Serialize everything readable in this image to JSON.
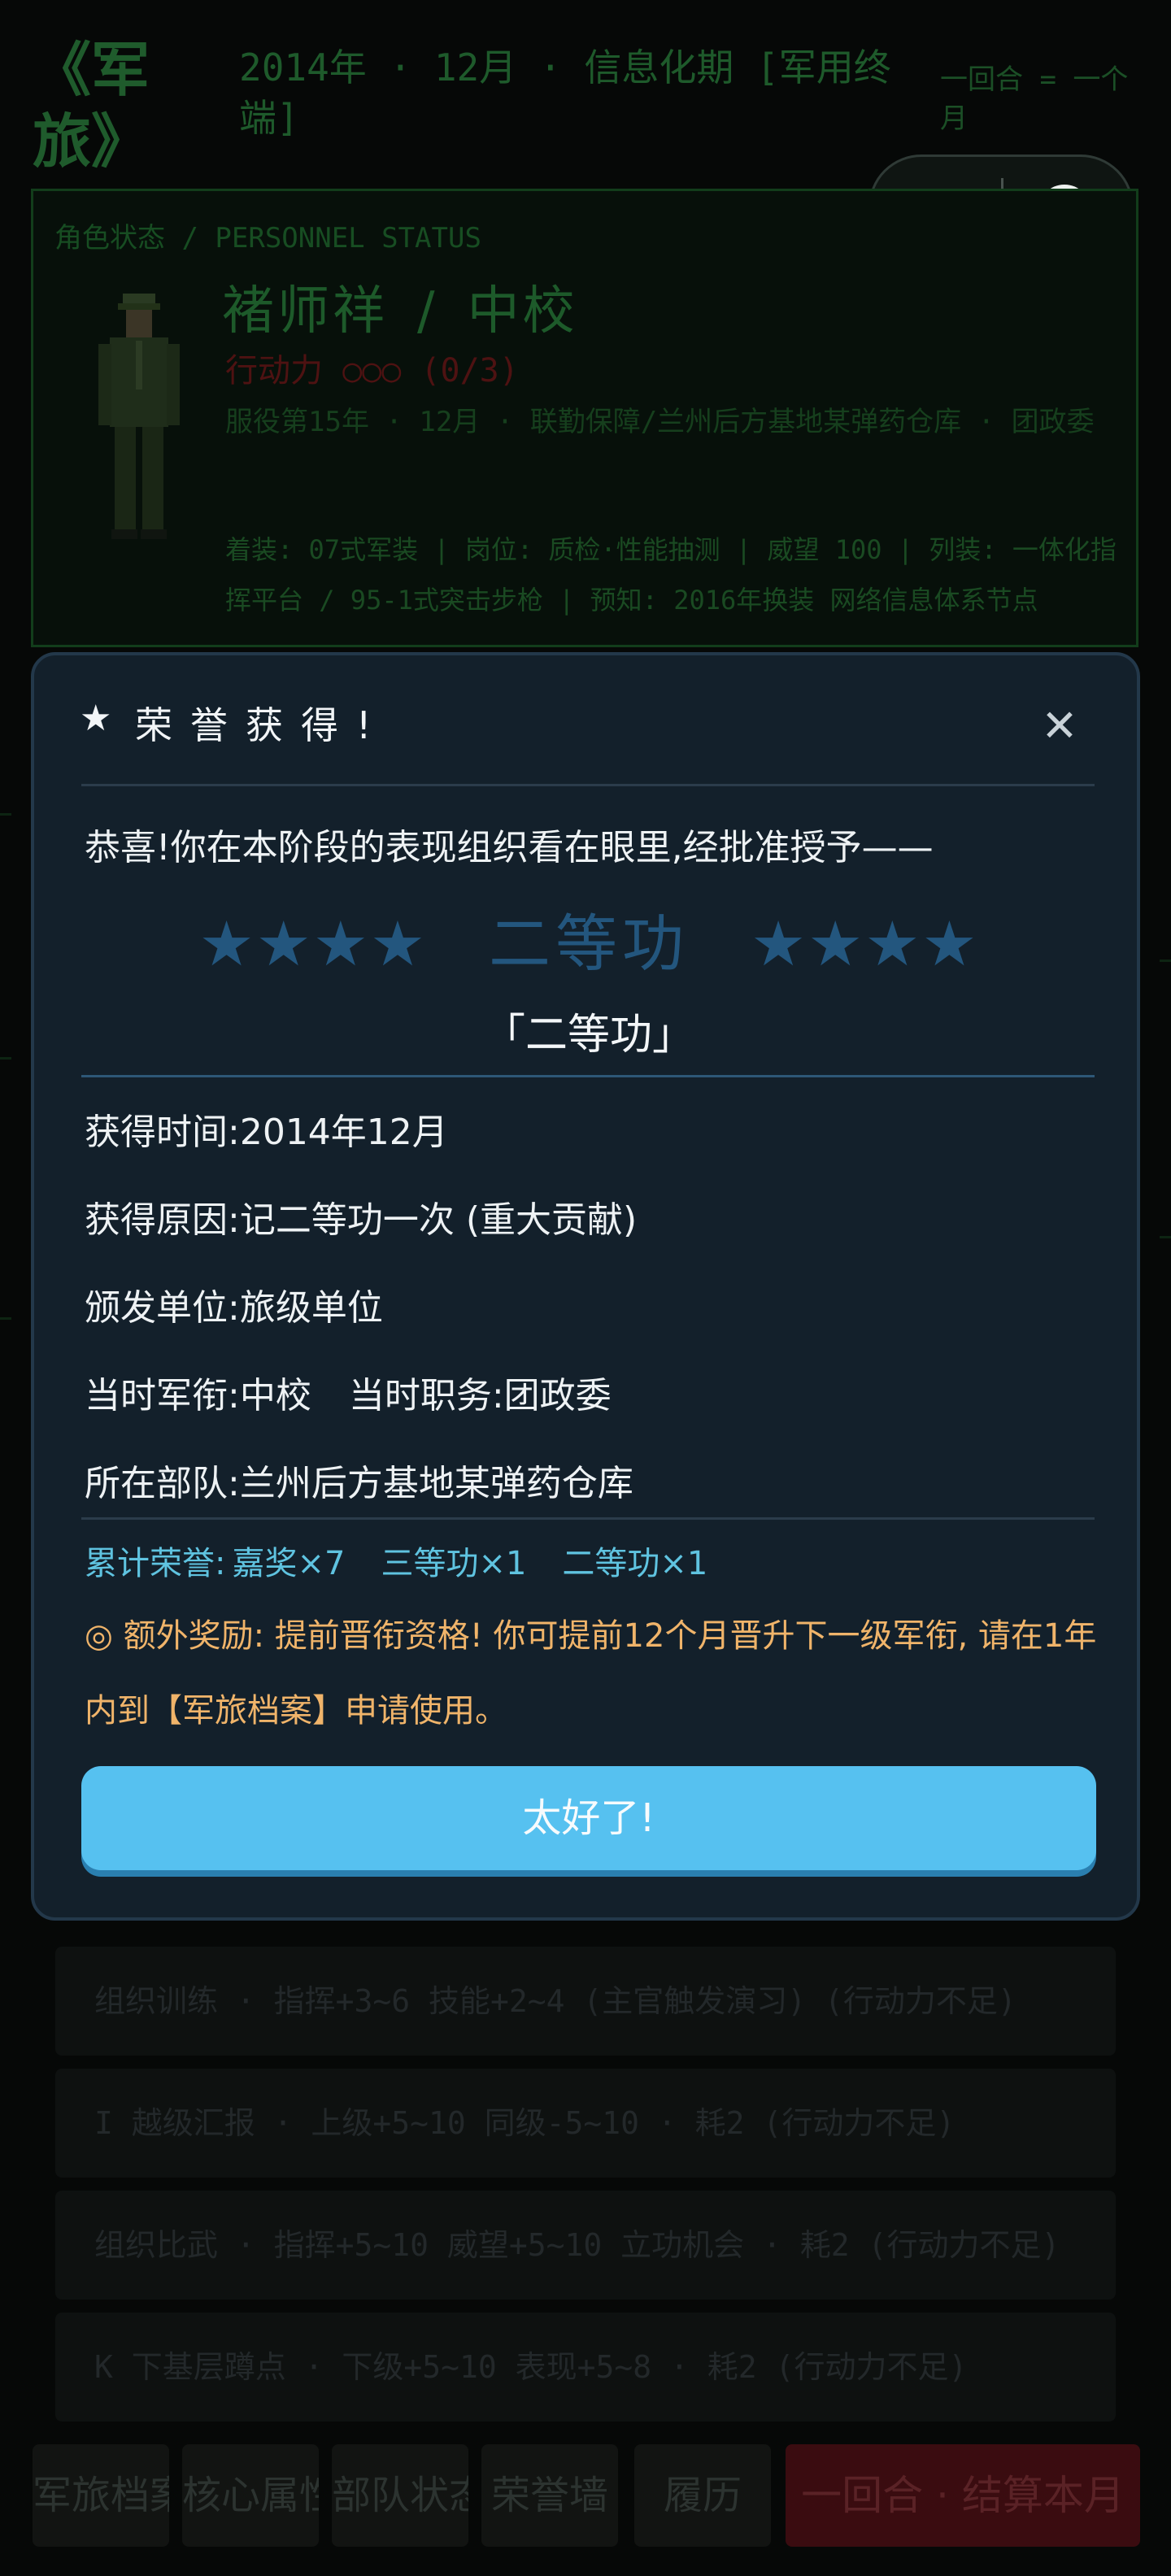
{
  "header": {
    "game_title": "《军旅》",
    "era_line": "2014年 · 12月 · 信息化期 [军用终端]",
    "round_note": "一回合 = 一个月"
  },
  "status_panel": {
    "header": "角色状态 / PERSONNEL STATUS",
    "name": "褚师祥",
    "separator": "/",
    "rank": "中校",
    "action_points": "行动力 ○○○ (0/3)",
    "service_line": "服役第15年 · 12月 · 联勤保障/兰州后方基地某弹药仓库 · 团政委",
    "equip_line": "着装: 07式军装 | 岗位: 质检·性能抽测 | 威望 100 | 列装: 一体化指挥平台 / 95-1式突击步枪 | 预知: 2016年换装 网络信息体系节点"
  },
  "action_rows": [
    "组织训练 · 指挥+3~6 技能+2~4 (主官触发演习) (行动力不足)",
    "I  越级汇报 · 上级+5~10 同级-5~10 · 耗2 (行动力不足)",
    "组织比武 · 指挥+5~10 威望+5~10 立功机会 · 耗2 (行动力不足)",
    "K  下基层蹲点 · 下级+5~10 表现+5~8 · 耗2 (行动力不足)"
  ],
  "nav": {
    "archive": "军旅档案",
    "attributes": "核心属性",
    "unit_status": "部队状态",
    "honor_wall": "荣誉墙",
    "resume": "履历",
    "end_turn": "一回合 · 结算本月"
  },
  "modal": {
    "star_icon": "★",
    "title": "荣誉获得!",
    "close_icon": "✕",
    "congrats": "恭喜!你在本阶段的表现组织看在眼里,经批准授予——",
    "stars_left": "★★★★",
    "award_name": "二等功",
    "stars_right": "★★★★",
    "award_quote": "「二等功」",
    "time_label": "获得时间:",
    "time_value": "2014年12月",
    "reason_label": "获得原因:",
    "reason_value": "记二等功一次 (重大贡献)",
    "issuer_label": "颁发单位:",
    "issuer_value": "旅级单位",
    "rank_label": "当时军衔:",
    "rank_value": "中校",
    "post_label": "当时职务:",
    "post_value": "团政委",
    "unit_label": "所在部队:",
    "unit_value": "兰州后方基地某弹药仓库",
    "cumulative_label": "累计荣誉:",
    "cumulative_items": [
      "嘉奖×7",
      "三等功×1",
      "二等功×1"
    ],
    "bonus_text": "◎ 额外奖励: 提前晋衔资格! 你可提前12个月晋升下一级军衔, 请在1年内到【军旅档案】申请使用。",
    "confirm_label": "太好了!"
  },
  "colors": {
    "terminal_green": "#1d5a2a",
    "modal_bg": "#13202b",
    "award_blue": "#23567e",
    "cumulative_cyan": "#5fc3e0",
    "bonus_orange": "#f0b46a",
    "confirm_button": "#56c1f0",
    "end_turn_red": "#3a0c10"
  }
}
